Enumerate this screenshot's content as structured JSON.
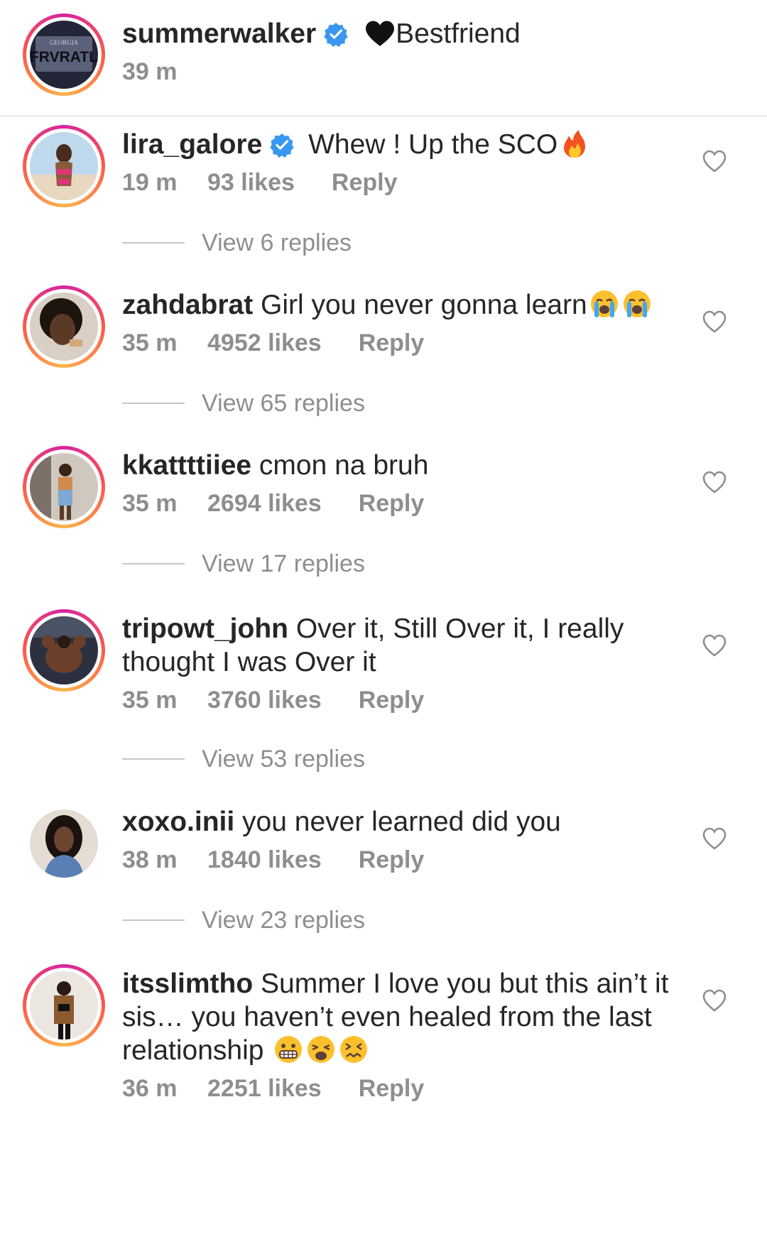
{
  "caption": {
    "username": "summerwalker",
    "text": "Bestfriend",
    "time": "39 m",
    "avatar_plate_top": "GEORGIA",
    "avatar_plate_main": "FRVRATL"
  },
  "comments": [
    {
      "username": "lira_galore",
      "verified": true,
      "text": "Whew ! Up the SCO",
      "emojis": [
        "fire"
      ],
      "time": "19 m",
      "likes": "93 likes",
      "reply": "Reply",
      "view_replies": "View 6 replies"
    },
    {
      "username": "zahdabrat",
      "verified": false,
      "text": "Girl you never gonna learn",
      "emojis": [
        "loudly-crying-face",
        "loudly-crying-face"
      ],
      "time": "35 m",
      "likes": "4952 likes",
      "reply": "Reply",
      "view_replies": "View 65 replies"
    },
    {
      "username": "kkattttiiee",
      "verified": false,
      "text": "cmon na bruh",
      "emojis": [],
      "time": "35 m",
      "likes": "2694 likes",
      "reply": "Reply",
      "view_replies": "View 17 replies"
    },
    {
      "username": "tripowt_john",
      "verified": false,
      "text": "Over it, Still Over it, I really thought I was Over it",
      "emojis": [],
      "time": "35 m",
      "likes": "3760 likes",
      "reply": "Reply",
      "view_replies": "View 53 replies"
    },
    {
      "username": "xoxo.inii",
      "verified": false,
      "text": "you never learned did you",
      "emojis": [],
      "time": "38 m",
      "likes": "1840 likes",
      "reply": "Reply",
      "view_replies": "View 23 replies"
    },
    {
      "username": "itsslimtho",
      "verified": false,
      "text": "Summer I love you but this ain’t it sis… you haven’t even healed from the last relationship",
      "emojis": [
        "grimacing-face",
        "weary-face",
        "confounded-face"
      ],
      "time": "36 m",
      "likes": "2251 likes",
      "reply": "Reply",
      "view_replies": ""
    }
  ],
  "colors": {
    "text": "#262626",
    "meta": "#8e8e8e",
    "verified": "#3897f0",
    "divider": "#ececec"
  },
  "icons": {
    "verified": "verified-badge-icon",
    "like": "heart-outline-icon",
    "caption_emoji": "black-heart-icon"
  }
}
